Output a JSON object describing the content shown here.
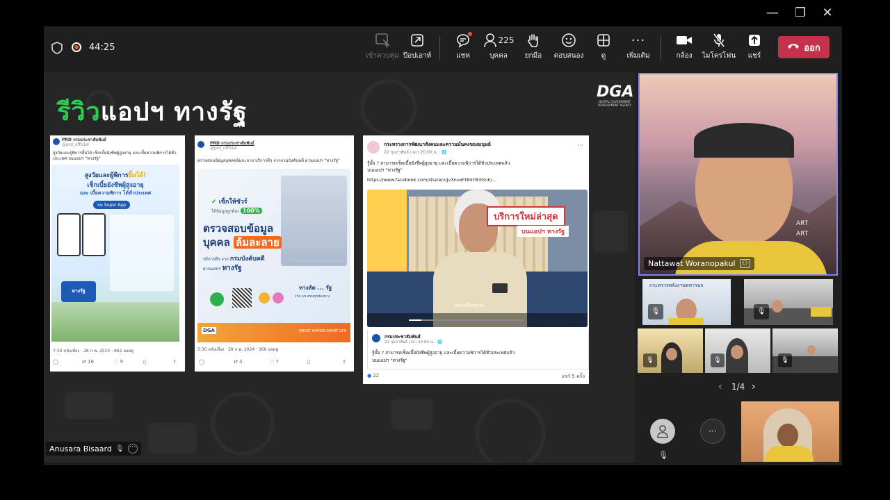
{
  "window": {
    "minimize": "—",
    "maximize": "❐",
    "close": "✕"
  },
  "meeting": {
    "timer": "44:25"
  },
  "toolbar": {
    "take_control": "เข้าควบคุม",
    "popout": "ป๊อปเอาท์",
    "chat": "แชท",
    "people_label": "บุคคล",
    "people_count": "225",
    "raise_hand": "ยกมือ",
    "react": "ตอบสนอง",
    "view": "ดู",
    "more": "เพิ่มเติม",
    "camera": "กล้อง",
    "mic": "ไมโครโฟน",
    "share": "แชร์",
    "leave": "ออก"
  },
  "slide": {
    "title_green": "รีวิว",
    "title_white": "แอปฯ ทางรัฐ",
    "logo": "DGA",
    "logo_sub1": "DIGITAL GOVERNMENT",
    "logo_sub2": "DEVELOPMENT AGENCY",
    "card1": {
      "account": "PRD กรมประชาสัมพันธ์",
      "handle": "@prd_official",
      "text": "สูงวัยและผู้พิการยิ้มได้ เช็กเบี้ยยังชีพผู้สูงอายุ และเบี้ยความพิการได้ทั่วประเทศ บนแอปฯ \"ทางรัฐ\"",
      "headline1": "สูงวัยและผู้พิการ",
      "headline_em": "ยิ้มได้!",
      "headline2": "เช็กเบี้ยยังชีพผู้สูงอายุ",
      "headline3": "และ เบี้ยความพิการ ได้ทั่วประเทศ",
      "badge": "บน Super App",
      "app_name": "ทางรัฐ",
      "meta": "7:30 หลังเที่ยง · 28 ก.พ. 2024 · 862 ยอดดู",
      "retweets": "16",
      "likes": "9"
    },
    "card2": {
      "account": "PRD กรมประชาสัมพันธ์",
      "handle": "@prd_official",
      "text": "ตรวจสอบข้อมูลบุคคลล้มละลาย บริการดีๆ จากกรมบังคับคดี ผ่านแอปฯ \"ทางรัฐ\"",
      "check": "เช็กให้ชัวร์",
      "check_sub": "ได้ข้อมูลถูกต้อง",
      "percent": "100%",
      "headline1": "ตรวจสอบข้อมูล",
      "headline2a": "บุคคล",
      "headline2b": "ล้มละลาย",
      "sub1": "บริการดีๆ จาก",
      "sub1b": "กรมบังคับคดี",
      "sub2": "ผ่านแอปฯ",
      "sub2b": "ทางรัฐ",
      "app_title": "ทางลัด ... รัฐ",
      "app_sub": "ง่าย จบ ครบทุกช่องทาง",
      "footer": "SMART NATION SMART LIFE",
      "meta": "5:30 หลังเที่ยง · 28 ก.พ. 2024 · 366 ยอดดู",
      "retweets": "4",
      "likes": "7"
    },
    "card3": {
      "account": "กระทรวงการพัฒนาสังคมและความมั่นคงของมนุษย์",
      "date": "22 กุมภาพันธ์ เวลา 20:00 น. · 🌐",
      "text1": "รู้มั้ย ? สามารถเช็คเบี้ยยังชีพผู้สูงอายุ และเบี้ยความพิการได้ทั่วประเทศแล้ว",
      "text2": "บนแอปฯ \"ทางรัฐ\"",
      "link": "https://www.facebook.com/share/v/jv3nuxFtB4YB3GnK/...",
      "overlay1": "บริการใหม่ล่าสุด",
      "overlay2": "บนแอปฯ ทางรัฐ",
      "click_more": "คลิกเพื่อขยาย",
      "video_time": "0:09 / 1:25",
      "shared_account": "กรมประชาสัมพันธ์",
      "shared_date": "21 กุมภาพันธ์ เวลา 20:00 น. · 🌐",
      "shared_text1": "รู้มั้ย ? สามารถเช็คเบี้ยยังชีพผู้สูงอายุ และเบี้ยความพิการได้ทั่วประเทศแล้ว",
      "shared_text2": "บนแอปฯ \"ทางรัฐ\"",
      "reactions": "22",
      "shares": "แชร์ 5 ครั้ง"
    },
    "presenter_label": "Anusara Bisaard"
  },
  "participants": {
    "main_name": "Nattawat Woranopakul",
    "bg_text1": "ART",
    "bg_text2": "ART",
    "org_banner": "กระทรวงพลังงานทหารบก",
    "pager": "1/4",
    "more_dots": "···"
  }
}
